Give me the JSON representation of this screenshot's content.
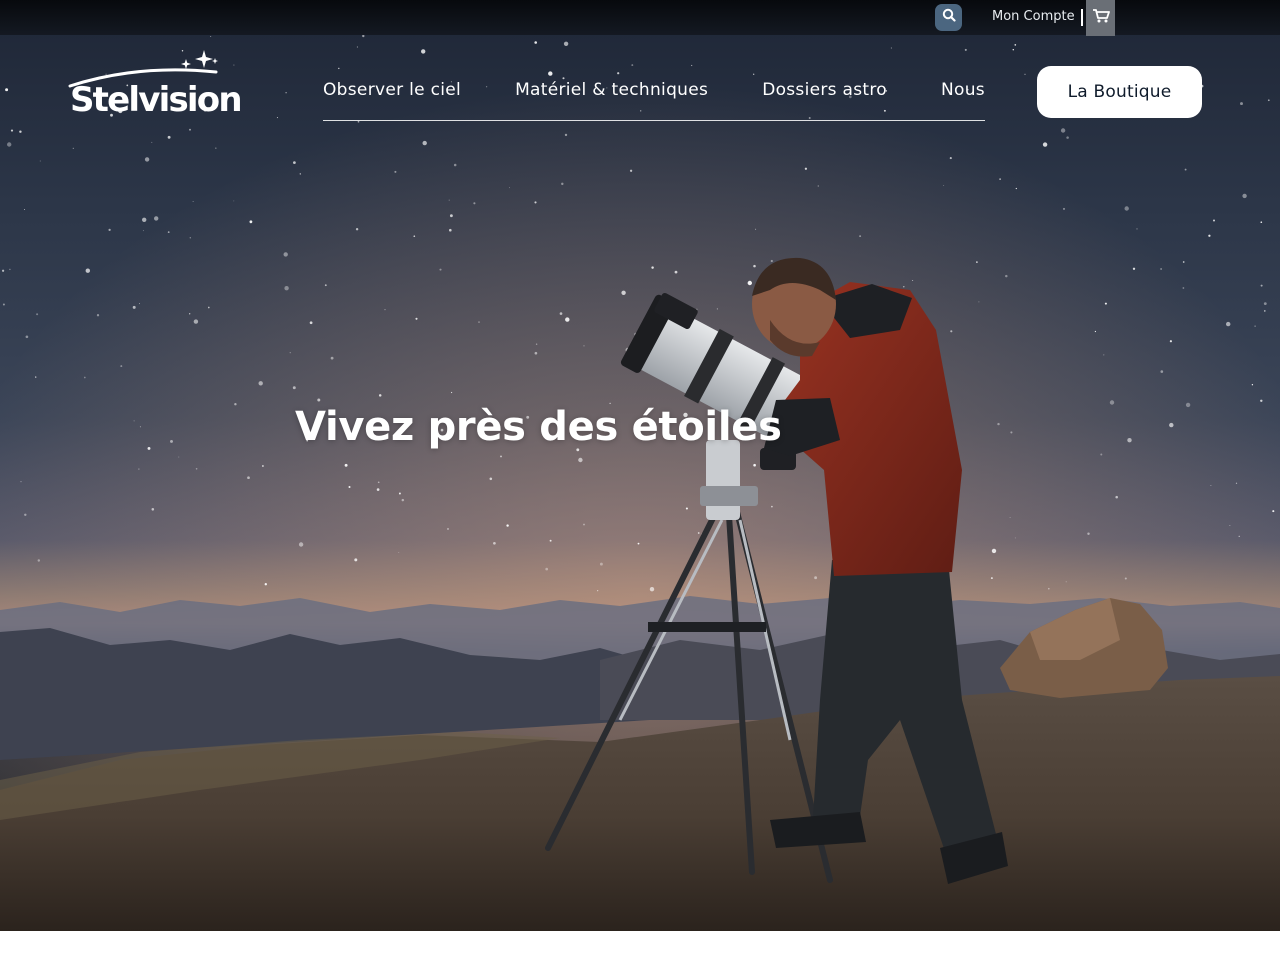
{
  "topbar": {
    "search_icon": "search-icon",
    "account_label": "Mon Compte",
    "cart_icon": "cart-icon"
  },
  "brand": {
    "name": "Stelvision",
    "logo_icon": "stars-arc-icon"
  },
  "nav": {
    "items": [
      {
        "label": "Observer le ciel"
      },
      {
        "label": "Matériel & techniques"
      },
      {
        "label": "Dossiers astro"
      },
      {
        "label": "Nous"
      }
    ]
  },
  "shop_button": {
    "label": "La Boutique"
  },
  "hero": {
    "title": "Vivez près des étoiles",
    "image_subject": "astronomer-with-telescope-photo"
  },
  "colors": {
    "topbar_bg": "#0b0e13",
    "search_bg": "#4b6680",
    "cart_bg": "#6a6f76",
    "shop_button_bg": "#ffffff",
    "shop_button_text": "#0f1b2b",
    "text_on_hero": "#ffffff"
  }
}
